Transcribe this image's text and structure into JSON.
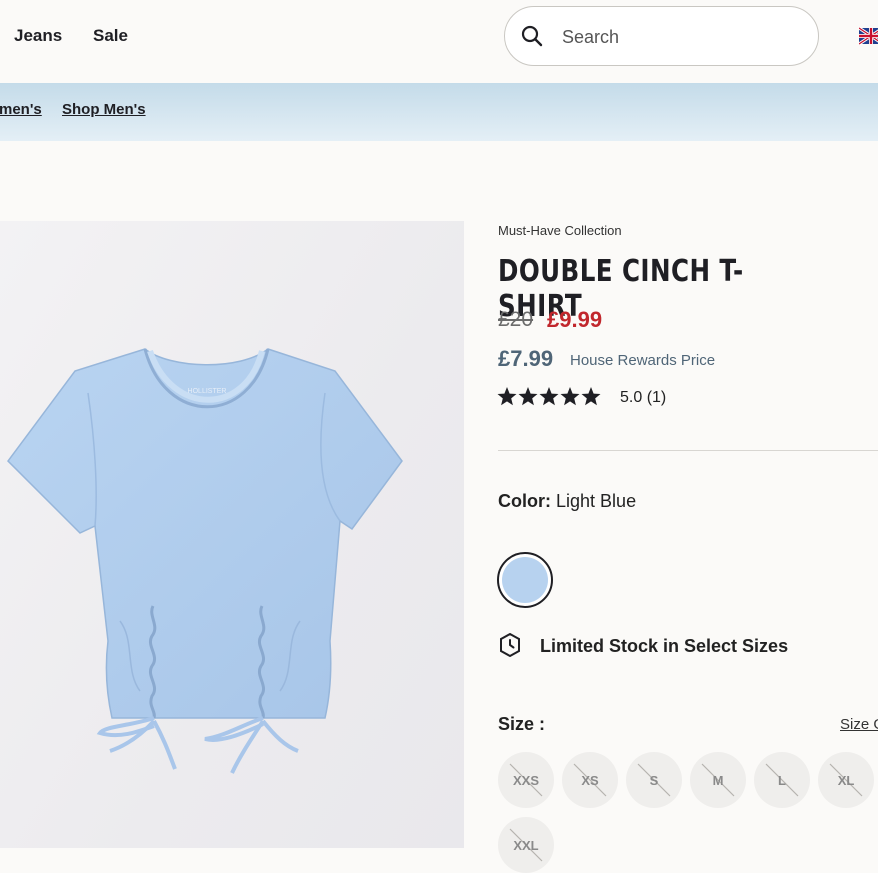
{
  "header": {
    "nav": [
      {
        "label": "Jeans"
      },
      {
        "label": "Sale"
      }
    ],
    "search": {
      "placeholder": "Search"
    },
    "flag_icon": "uk-flag-icon"
  },
  "promo_bar": {
    "links": [
      {
        "label": "men's"
      },
      {
        "label": "Shop Men's"
      }
    ]
  },
  "product": {
    "collection": "Must-Have Collection",
    "title": "DOUBLE CINCH T-SHIRT",
    "price_original": "£20",
    "price_sale": "£9.99",
    "rewards_price": "£7.99",
    "rewards_label": "House Rewards Price",
    "rating": {
      "stars": 5,
      "text": "5.0 (1)"
    },
    "color_label": "Color:",
    "color_value": "Light Blue",
    "swatch_color": "#b7d2ef",
    "stock_message": "Limited Stock in Select Sizes",
    "size_label": "Size :",
    "size_guide": "Size G",
    "sizes": [
      "XXS",
      "XS",
      "S",
      "M",
      "L",
      "XL",
      "XXL"
    ]
  },
  "colors": {
    "sale_red": "#c1272d",
    "rewards_slate": "#4f6577",
    "promo_blue": "#c4dbe9"
  }
}
